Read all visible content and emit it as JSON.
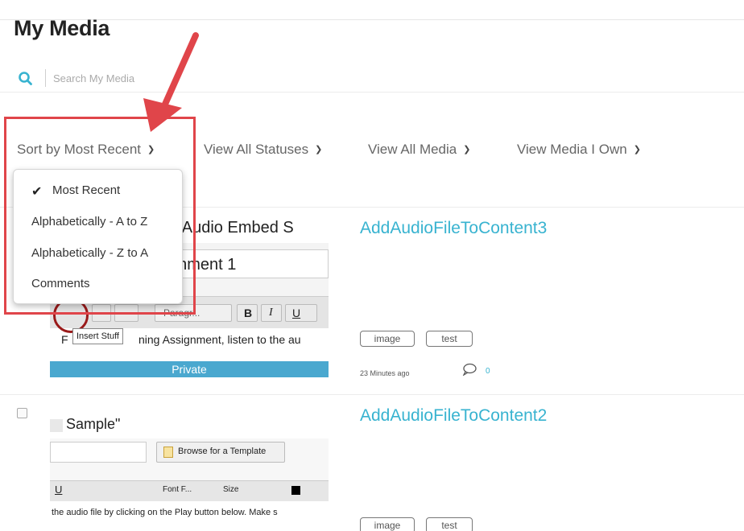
{
  "page": {
    "title": "My Media"
  },
  "search": {
    "placeholder": "Search My Media"
  },
  "filters": {
    "sort_label": "Sort by Most Recent",
    "statuses_label": "View All Statuses",
    "media_label": "View All Media",
    "own_label": "View Media I Own"
  },
  "sort_menu": {
    "items": [
      {
        "label": "Most Recent",
        "checked": true
      },
      {
        "label": "Alphabetically - A to Z",
        "checked": false
      },
      {
        "label": "Alphabetically - Z to A",
        "checked": false
      },
      {
        "label": "Comments",
        "checked": false
      }
    ]
  },
  "media": [
    {
      "title": "AddAudioFileToContent3",
      "tags": [
        "image",
        "test"
      ],
      "time": "23 Minutes ago",
      "comments": "0",
      "status": "Private",
      "thumb": {
        "line1": "n \"Audio Embed S",
        "line2": "gnment 1",
        "tooltip": "Insert Stuff",
        "paragraph": "Paragr...",
        "body": "ning Assignment, listen to the au",
        "prefix": "F"
      }
    },
    {
      "title": "AddAudioFileToContent2",
      "tags": [
        "image",
        "test"
      ],
      "thumb": {
        "line1": "Sample\"",
        "browse": "Browse for a Template",
        "font": "Font F...",
        "size": "Size",
        "body": "the audio file by clicking on the Play button below.  Make s"
      }
    }
  ],
  "colors": {
    "link": "#38b3d0",
    "annotation": "#e0454a",
    "status_bar": "#4aa8cf"
  }
}
